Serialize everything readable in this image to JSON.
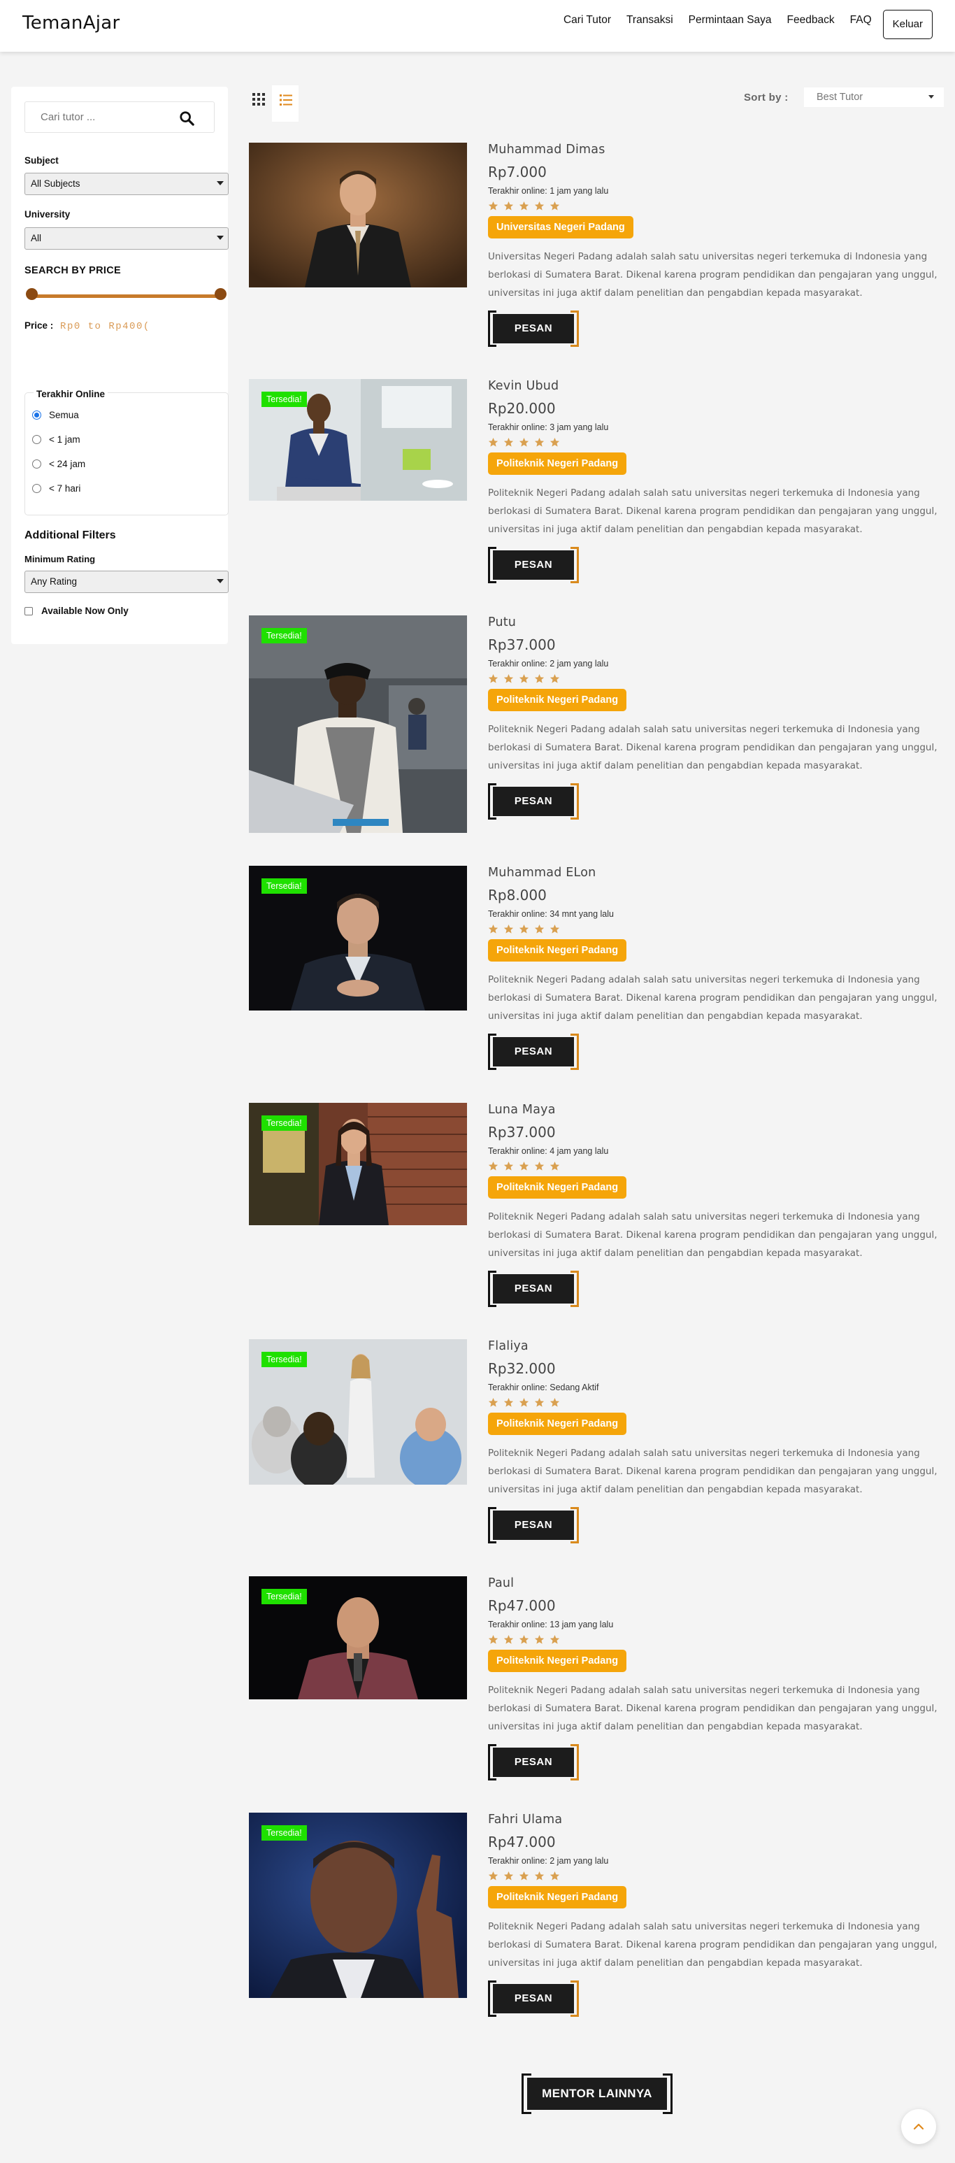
{
  "header": {
    "brand": "TemanAjar",
    "nav": [
      "Cari Tutor",
      "Transaksi",
      "Permintaan Saya",
      "Feedback",
      "FAQ"
    ],
    "logout_label": "Keluar"
  },
  "sidebar": {
    "search_placeholder": "Cari tutor ...",
    "subject_label": "Subject",
    "subject_value": "All Subjects",
    "university_label": "University",
    "university_value": "All",
    "price_heading": "SEARCH BY PRICE",
    "price_label": "Price :",
    "price_value": "Rp0 to Rp400(",
    "online_title": "Terakhir Online",
    "online_options": [
      "Semua",
      "< 1 jam",
      "< 24 jam",
      "< 7 hari"
    ],
    "online_selected": "Semua",
    "additional_title": "Additional Filters",
    "rating_label": "Minimum Rating",
    "rating_value": "Any Rating",
    "available_label": "Available Now Only"
  },
  "toolbar": {
    "sort_label": "Sort by :",
    "sort_value": "Best Tutor"
  },
  "colors": {
    "accent": "#f5a50a",
    "slider": "#c77a2a",
    "badge": "#1fe000",
    "button": "#1c1c1c"
  },
  "tutors": [
    {
      "name": "Muhammad Dimas",
      "price": "Rp7.000",
      "online": "Terakhir online: 1 jam yang lalu",
      "university": "Universitas Negeri Padang",
      "badge": "",
      "rating": 5,
      "desc": "Universitas Negeri Padang adalah salah satu universitas negeri terkemuka di Indonesia yang berlokasi di Sumatera Barat. Dikenal karena program pendidikan dan pengajaran yang unggul, universitas ini juga aktif dalam penelitian dan pengabdian kepada masyarakat."
    },
    {
      "name": "Kevin Ubud",
      "price": "Rp20.000",
      "online": "Terakhir online: 3 jam yang lalu",
      "university": "Politeknik Negeri Padang",
      "badge": "Tersedia!",
      "rating": 5,
      "desc": "Politeknik Negeri Padang adalah salah satu universitas negeri terkemuka di Indonesia yang berlokasi di Sumatera Barat. Dikenal karena program pendidikan dan pengajaran yang unggul, universitas ini juga aktif dalam penelitian dan pengabdian kepada masyarakat."
    },
    {
      "name": "Putu",
      "price": "Rp37.000",
      "online": "Terakhir online: 2 jam yang lalu",
      "university": "Politeknik Negeri Padang",
      "badge": "Tersedia!",
      "rating": 5,
      "desc": "Politeknik Negeri Padang adalah salah satu universitas negeri terkemuka di Indonesia yang berlokasi di Sumatera Barat. Dikenal karena program pendidikan dan pengajaran yang unggul, universitas ini juga aktif dalam penelitian dan pengabdian kepada masyarakat."
    },
    {
      "name": "Muhammad ELon",
      "price": "Rp8.000",
      "online": "Terakhir online: 34 mnt yang lalu",
      "university": "Politeknik Negeri Padang",
      "badge": "Tersedia!",
      "rating": 5,
      "desc": "Politeknik Negeri Padang adalah salah satu universitas negeri terkemuka di Indonesia yang berlokasi di Sumatera Barat. Dikenal karena program pendidikan dan pengajaran yang unggul, universitas ini juga aktif dalam penelitian dan pengabdian kepada masyarakat."
    },
    {
      "name": "Luna Maya",
      "price": "Rp37.000",
      "online": "Terakhir online: 4 jam yang lalu",
      "university": "Politeknik Negeri Padang",
      "badge": "Tersedia!",
      "rating": 5,
      "desc": "Politeknik Negeri Padang adalah salah satu universitas negeri terkemuka di Indonesia yang berlokasi di Sumatera Barat. Dikenal karena program pendidikan dan pengajaran yang unggul, universitas ini juga aktif dalam penelitian dan pengabdian kepada masyarakat."
    },
    {
      "name": "Flaliya",
      "price": "Rp32.000",
      "online": "Terakhir online: Sedang Aktif",
      "university": "Politeknik Negeri Padang",
      "badge": "Tersedia!",
      "rating": 5,
      "desc": "Politeknik Negeri Padang adalah salah satu universitas negeri terkemuka di Indonesia yang berlokasi di Sumatera Barat. Dikenal karena program pendidikan dan pengajaran yang unggul, universitas ini juga aktif dalam penelitian dan pengabdian kepada masyarakat."
    },
    {
      "name": "Paul",
      "price": "Rp47.000",
      "online": "Terakhir online: 13 jam yang lalu",
      "university": "Politeknik Negeri Padang",
      "badge": "Tersedia!",
      "rating": 5,
      "desc": "Politeknik Negeri Padang adalah salah satu universitas negeri terkemuka di Indonesia yang berlokasi di Sumatera Barat. Dikenal karena program pendidikan dan pengajaran yang unggul, universitas ini juga aktif dalam penelitian dan pengabdian kepada masyarakat."
    },
    {
      "name": "Fahri Ulama",
      "price": "Rp47.000",
      "online": "Terakhir online: 2 jam yang lalu",
      "university": "Politeknik Negeri Padang",
      "badge": "Tersedia!",
      "rating": 5,
      "desc": "Politeknik Negeri Padang adalah salah satu universitas negeri terkemuka di Indonesia yang berlokasi di Sumatera Barat. Dikenal karena program pendidikan dan pengajaran yang unggul, universitas ini juga aktif dalam penelitian dan pengabdian kepada masyarakat."
    }
  ],
  "order_label": "PESAN",
  "more_label": "MENTOR LAINNYA"
}
